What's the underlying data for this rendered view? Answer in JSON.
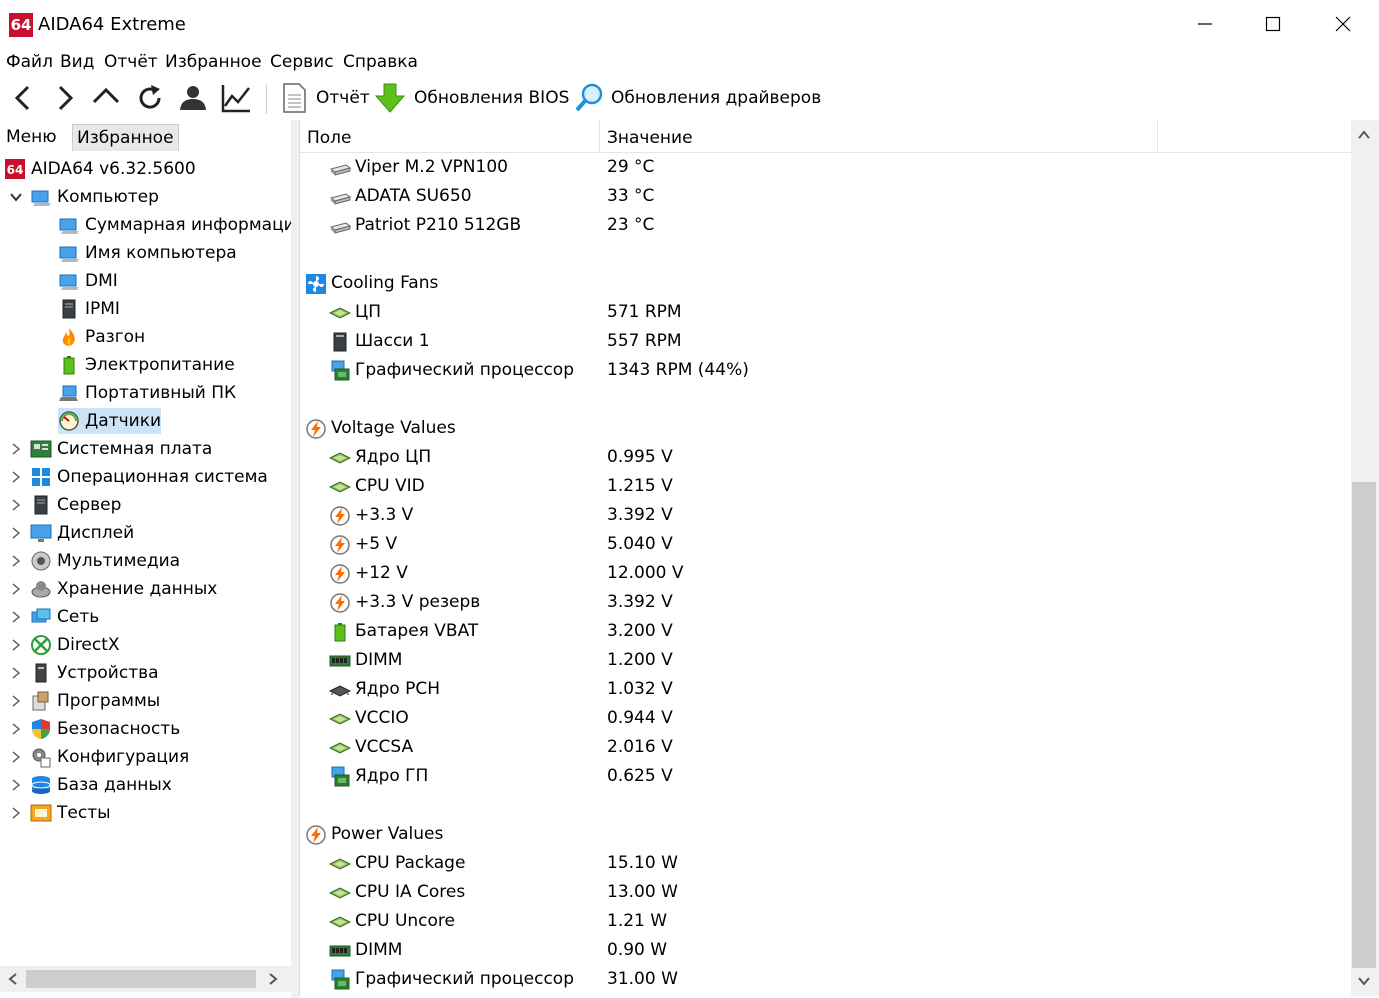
{
  "window": {
    "title": "AIDA64 Extreme",
    "logo": "64"
  },
  "menu": [
    "Файл",
    "Вид",
    "Отчёт",
    "Избранное",
    "Сервис",
    "Справка"
  ],
  "toolbar": {
    "report": "Отчёт",
    "bios": "Обновления BIOS",
    "drivers": "Обновления драйверов"
  },
  "tabs": {
    "menu": "Меню",
    "favorites": "Избранное"
  },
  "tree": [
    {
      "label": "AIDA64 v6.32.5600",
      "icon": "aida64-logo-icon"
    },
    {
      "label": "Компьютер",
      "icon": "computer-icon"
    },
    {
      "label": "Суммарная информация",
      "icon": "computer-icon"
    },
    {
      "label": "Имя компьютера",
      "icon": "computer-icon"
    },
    {
      "label": "DMI",
      "icon": "computer-icon"
    },
    {
      "label": "IPMI",
      "icon": "server-icon"
    },
    {
      "label": "Разгон",
      "icon": "flame-icon"
    },
    {
      "label": "Электропитание",
      "icon": "battery-icon"
    },
    {
      "label": "Портативный ПК",
      "icon": "laptop-icon"
    },
    {
      "label": "Датчики",
      "icon": "gauge-icon"
    },
    {
      "label": "Системная плата",
      "icon": "motherboard-icon"
    },
    {
      "label": "Операционная система",
      "icon": "windows-icon"
    },
    {
      "label": "Сервер",
      "icon": "server-icon"
    },
    {
      "label": "Дисплей",
      "icon": "monitor-icon"
    },
    {
      "label": "Мультимедиа",
      "icon": "speaker-icon"
    },
    {
      "label": "Хранение данных",
      "icon": "disk-icon"
    },
    {
      "label": "Сеть",
      "icon": "network-icon"
    },
    {
      "label": "DirectX",
      "icon": "xbox-icon"
    },
    {
      "label": "Устройства",
      "icon": "devices-icon"
    },
    {
      "label": "Программы",
      "icon": "programs-icon"
    },
    {
      "label": "Безопасность",
      "icon": "shield-icon"
    },
    {
      "label": "Конфигурация",
      "icon": "config-icon"
    },
    {
      "label": "База данных",
      "icon": "database-icon"
    },
    {
      "label": "Тесты",
      "icon": "tests-icon"
    }
  ],
  "columns": {
    "field": "Поле",
    "value": "Значение"
  },
  "rows": [
    {
      "field": "Viper M.2 VPN100",
      "value": "29 °C",
      "icon": "drive-icon"
    },
    {
      "field": "ADATA SU650",
      "value": "33 °C",
      "icon": "drive-icon"
    },
    {
      "field": "Patriot P210 512GB",
      "value": "23 °C",
      "icon": "drive-icon"
    },
    {
      "field": "Cooling Fans",
      "value": "",
      "icon": "fan-icon"
    },
    {
      "field": "ЦП",
      "value": "571 RPM",
      "icon": "cpu-icon"
    },
    {
      "field": "Шасси 1",
      "value": "557 RPM",
      "icon": "chassis-icon"
    },
    {
      "field": "Графический процессор",
      "value": "1343 RPM  (44%)",
      "icon": "gpu-icon"
    },
    {
      "field": "Voltage Values",
      "value": "",
      "icon": "voltage-icon"
    },
    {
      "field": "Ядро ЦП",
      "value": "0.995 V",
      "icon": "cpu-icon"
    },
    {
      "field": "CPU VID",
      "value": "1.215 V",
      "icon": "cpu-icon"
    },
    {
      "field": "+3.3 V",
      "value": "3.392 V",
      "icon": "voltage-icon"
    },
    {
      "field": "+5 V",
      "value": "5.040 V",
      "icon": "voltage-icon"
    },
    {
      "field": "+12 V",
      "value": "12.000 V",
      "icon": "voltage-icon"
    },
    {
      "field": "+3.3 V резерв",
      "value": "3.392 V",
      "icon": "voltage-icon"
    },
    {
      "field": "Батарея VBAT",
      "value": "3.200 V",
      "icon": "battery-icon"
    },
    {
      "field": "DIMM",
      "value": "1.200 V",
      "icon": "dimm-icon"
    },
    {
      "field": "Ядро PCH",
      "value": "1.032 V",
      "icon": "chip-icon"
    },
    {
      "field": "VCCIO",
      "value": "0.944 V",
      "icon": "cpu-icon"
    },
    {
      "field": "VCCSA",
      "value": "2.016 V",
      "icon": "cpu-icon"
    },
    {
      "field": "Ядро ГП",
      "value": "0.625 V",
      "icon": "gpu-icon"
    },
    {
      "field": "Power Values",
      "value": "",
      "icon": "voltage-icon"
    },
    {
      "field": "CPU Package",
      "value": "15.10 W",
      "icon": "cpu-icon"
    },
    {
      "field": "CPU IA Cores",
      "value": "13.00 W",
      "icon": "cpu-icon"
    },
    {
      "field": "CPU Uncore",
      "value": "1.21 W",
      "icon": "cpu-icon"
    },
    {
      "field": "DIMM",
      "value": "0.90 W",
      "icon": "dimm-icon"
    },
    {
      "field": "Графический процессор",
      "value": "31.00 W",
      "icon": "gpu-icon"
    }
  ]
}
